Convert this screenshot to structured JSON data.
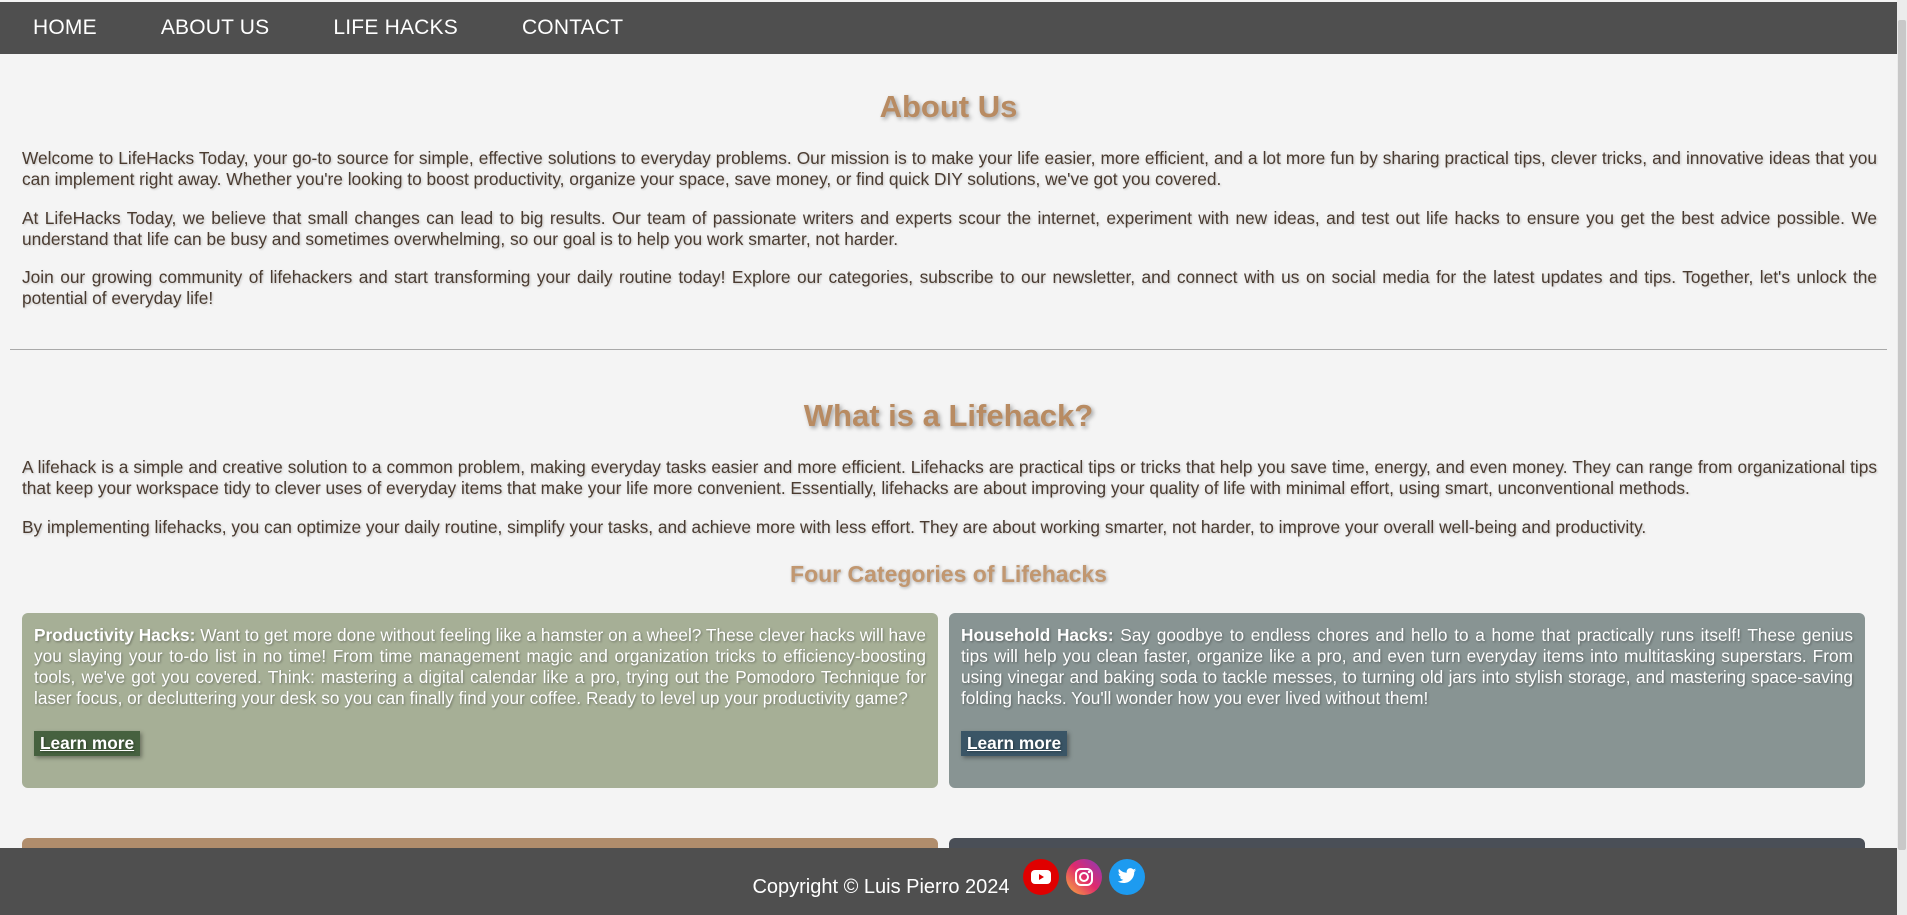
{
  "nav": {
    "items": [
      "HOME",
      "ABOUT US",
      "LIFE HACKS",
      "CONTACT"
    ]
  },
  "about": {
    "title": "About Us",
    "paragraphs": [
      "Welcome to LifeHacks Today, your go-to source for simple, effective solutions to everyday problems. Our mission is to make your life easier, more efficient, and a lot more fun by sharing practical tips, clever tricks, and innovative ideas that you can implement right away. Whether you're looking to boost productivity, organize your space, save money, or find quick DIY solutions, we've got you covered.",
      "At LifeHacks Today, we believe that small changes can lead to big results. Our team of passionate writers and experts scour the internet, experiment with new ideas, and test out life hacks to ensure you get the best advice possible. We understand that life can be busy and sometimes overwhelming, so our goal is to help you work smarter, not harder.",
      "Join our growing community of lifehackers and start transforming your daily routine today! Explore our categories, subscribe to our newsletter, and connect with us on social media for the latest updates and tips. Together, let's unlock the potential of everyday life!"
    ]
  },
  "lifehack": {
    "title": "What is a Lifehack?",
    "paragraphs": [
      "A lifehack is a simple and creative solution to a common problem, making everyday tasks easier and more efficient. Lifehacks are practical tips or tricks that help you save time, energy, and even money. They can range from organizational tips that keep your workspace tidy to clever uses of everyday items that make your life more convenient. Essentially, lifehacks are about improving your quality of life with minimal effort, using smart, unconventional methods.",
      "By implementing lifehacks, you can optimize your daily routine, simplify your tasks, and achieve more with less effort. They are about working smarter, not harder, to improve your overall well-being and productivity."
    ],
    "categories_title": "Four Categories of Lifehacks"
  },
  "cards": {
    "productivity": {
      "heading": "Productivity Hacks:",
      "text": " Want to get more done without feeling like a hamster on a wheel? These clever hacks will have you slaying your to-do list in no time! From time management magic and organization tricks to efficiency-boosting tools, we've got you covered. Think: mastering a digital calendar like a pro, trying out the Pomodoro Technique for laser focus, or decluttering your desk so you can finally find your coffee. Ready to level up your productivity game?",
      "button": "Learn more",
      "color": "#a6af96",
      "button_color": "#46613f"
    },
    "household": {
      "heading": "Household Hacks:",
      "text": " Say goodbye to endless chores and hello to a home that practically runs itself! These genius tips will help you clean faster, organize like a pro, and even turn everyday items into multitasking superstars. From using vinegar and baking soda to tackle messes, to turning old jars into stylish storage, and mastering space-saving folding hacks. You'll wonder how you ever lived without them!",
      "button": "Learn more",
      "color": "#889493",
      "button_color": "#3a5566"
    }
  },
  "footer": {
    "copyright": "Copyright © Luis Pierro 2024",
    "social": [
      "youtube-icon",
      "instagram-icon",
      "twitter-icon"
    ]
  }
}
